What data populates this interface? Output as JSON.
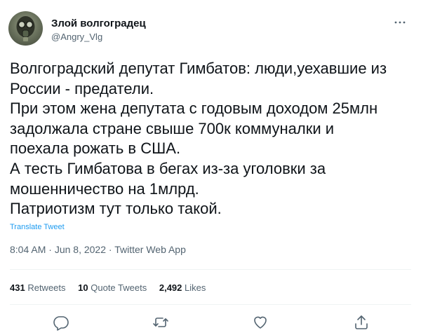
{
  "author": {
    "display_name": "Злой волгоградец",
    "handle": "@Angry_Vlg",
    "avatar_icon": "gas-mask-avatar"
  },
  "tweet": {
    "lines": [
      "Волгоградский депутат Гимбатов: люди,уехавшие из",
      "России - предатели.",
      "При этом жена депутата с годовым доходом 25млн",
      "задолжала стране свыше 700к коммуналки и",
      "поехала рожать в США.",
      "А тесть Гимбатова в бегах из-за уголовки за",
      "мошенничество на 1млрд.",
      "Патриотизм тут только такой."
    ],
    "translate_label": "Translate Tweet",
    "time": "8:04 AM",
    "date": "Jun 8, 2022",
    "source": "Twitter Web App",
    "separator": "·"
  },
  "stats": {
    "retweets": {
      "count": "431",
      "label": "Retweets"
    },
    "quotes": {
      "count": "10",
      "label": "Quote Tweets"
    },
    "likes": {
      "count": "2,492",
      "label": "Likes"
    }
  },
  "actions": [
    "reply-icon",
    "retweet-icon",
    "like-icon",
    "share-icon"
  ],
  "colors": {
    "text": "#0f1419",
    "secondary": "#536471",
    "link": "#1d9bf0",
    "divider": "#eff3f4"
  }
}
